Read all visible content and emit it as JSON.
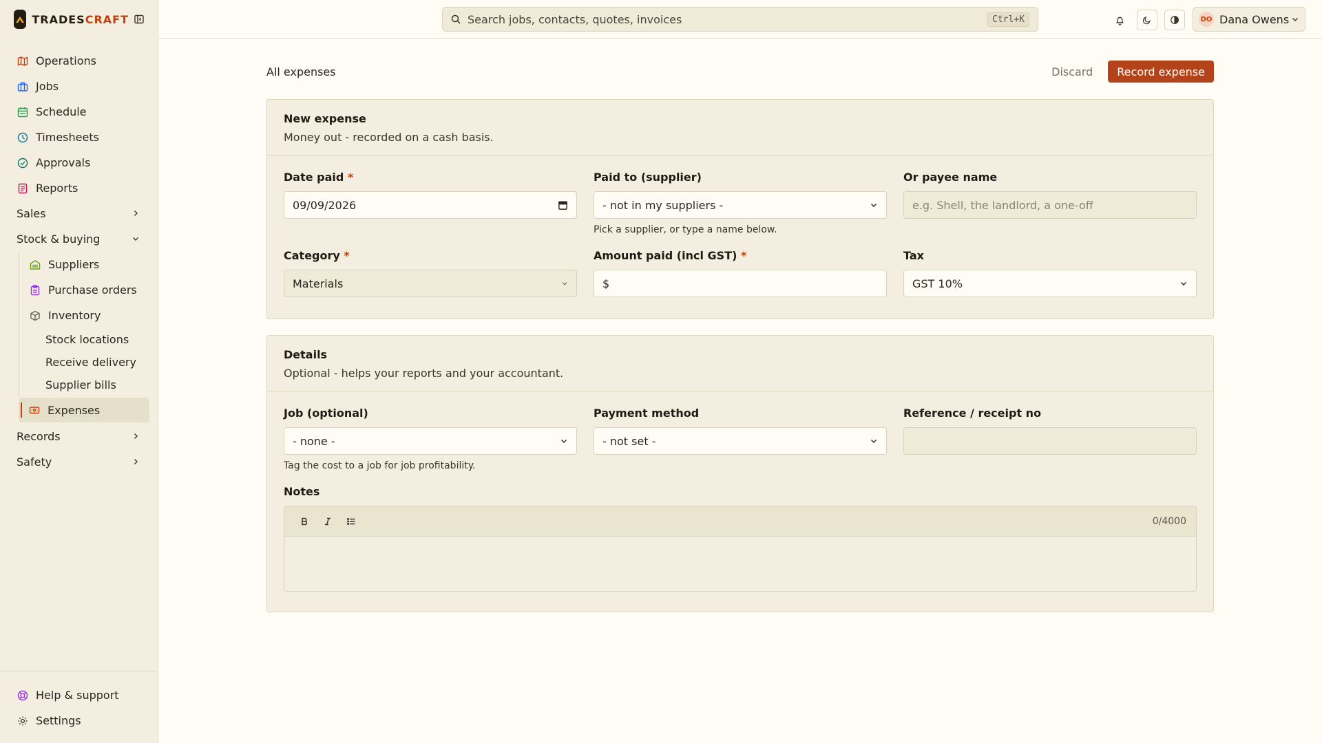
{
  "brand": {
    "part1": "TRADES",
    "part2": "CRAFT"
  },
  "sidebar": {
    "items": [
      {
        "label": "Operations",
        "icon": "map-icon"
      },
      {
        "label": "Jobs",
        "icon": "briefcase-icon"
      },
      {
        "label": "Schedule",
        "icon": "calendar-icon"
      },
      {
        "label": "Timesheets",
        "icon": "clock-icon"
      },
      {
        "label": "Approvals",
        "icon": "check-circle-icon"
      },
      {
        "label": "Reports",
        "icon": "report-icon"
      }
    ],
    "sales": "Sales",
    "stock": "Stock & buying",
    "stock_items": [
      {
        "label": "Suppliers"
      },
      {
        "label": "Purchase orders"
      },
      {
        "label": "Inventory"
      }
    ],
    "inventory_items": [
      "Stock locations",
      "Receive delivery",
      "Supplier bills"
    ],
    "expenses": "Expenses",
    "records": "Records",
    "safety": "Safety",
    "help": "Help & support",
    "settings": "Settings"
  },
  "topbar": {
    "search_placeholder": "Search jobs, contacts, quotes, invoices",
    "search_shortcut": "Ctrl+K",
    "user_initials": "DO",
    "user_name": "Dana Owens"
  },
  "page": {
    "back_link": "All expenses",
    "discard": "Discard",
    "record": "Record expense"
  },
  "expense_card": {
    "title": "New expense",
    "subtitle": "Money out - recorded on a cash basis.",
    "date_label": "Date paid",
    "date_value": "09/09/2026",
    "paid_to_label": "Paid to (supplier)",
    "paid_to_value": "- not in my suppliers -",
    "paid_to_hint": "Pick a supplier, or type a name below.",
    "payee_label": "Or payee name",
    "payee_placeholder": "e.g. Shell, the landlord, a one-off",
    "category_label": "Category",
    "category_value": "Materials",
    "amount_label": "Amount paid (incl GST)",
    "amount_prefix": "$",
    "tax_label": "Tax",
    "tax_value": "GST 10%",
    "required_mark": "*"
  },
  "details_card": {
    "title": "Details",
    "subtitle": "Optional - helps your reports and your accountant.",
    "job_label": "Job (optional)",
    "job_value": "- none -",
    "job_hint": "Tag the cost to a job for job profitability.",
    "payment_label": "Payment method",
    "payment_value": "- not set -",
    "reference_label": "Reference / receipt no",
    "notes_label": "Notes",
    "notes_counter": "0/4000"
  }
}
